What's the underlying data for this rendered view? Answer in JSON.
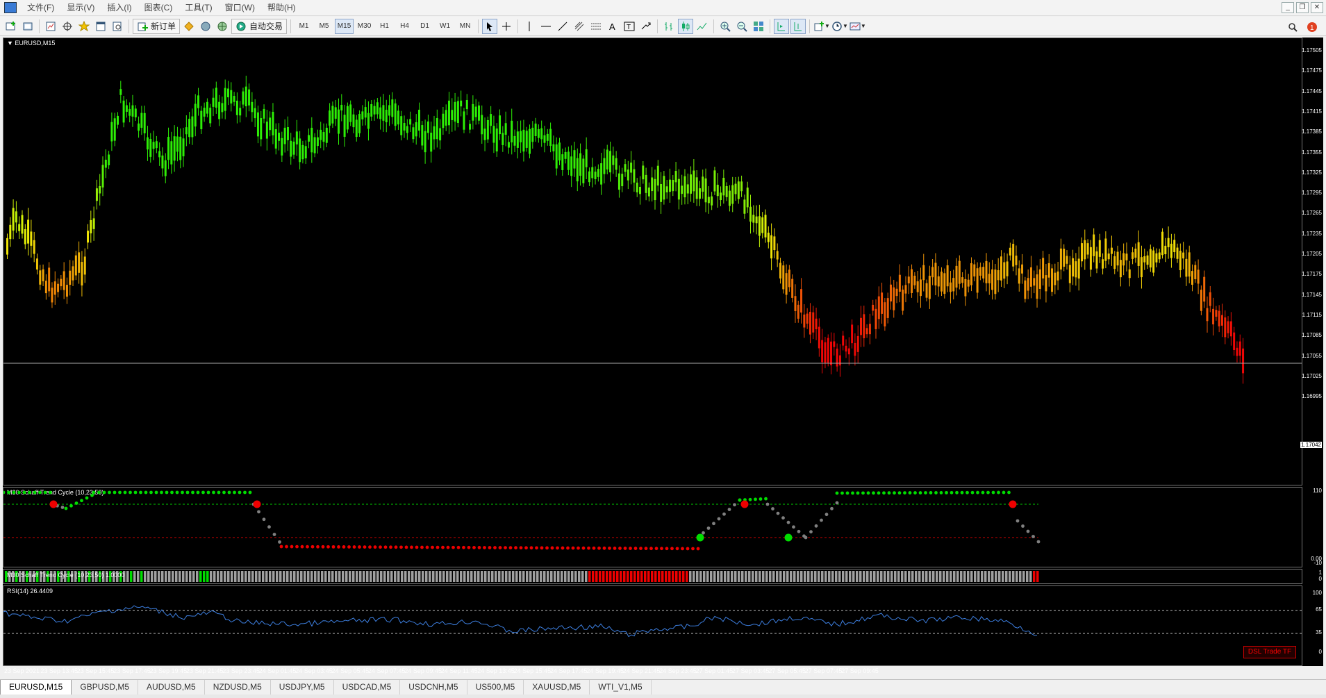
{
  "menu": [
    "文件(F)",
    "显示(V)",
    "插入(I)",
    "图表(C)",
    "工具(T)",
    "窗口(W)",
    "帮助(H)"
  ],
  "toolbar": {
    "new_order": "新订单",
    "auto_trading": "自动交易",
    "timeframes": [
      "M1",
      "M5",
      "M15",
      "M30",
      "H1",
      "H4",
      "D1",
      "W1",
      "MN"
    ],
    "active_timeframe": "M15"
  },
  "chart": {
    "title": "EURUSD,M15",
    "current_price": "1.17042",
    "price_labels": [
      "1.17505",
      "1.17475",
      "1.17445",
      "1.17415",
      "1.17385",
      "1.17355",
      "1.17325",
      "1.17295",
      "1.17265",
      "1.17235",
      "1.17205",
      "1.17175",
      "1.17145",
      "1.17115",
      "1.17085",
      "1.17055",
      "1.17025",
      "1.16995"
    ],
    "stc_title": "M30 Schaff Trend Cycle (10,23,50)",
    "stc_bar_title": "M30 Schaff Trend Cycle (10,23,50) 1.0000",
    "stc_axis": [
      "110",
      "0.00",
      "-10"
    ],
    "stc_bar_axis": [
      "1",
      "0"
    ],
    "rsi_title": "RSI(14) 26.4409",
    "rsi_axis": [
      "100",
      "65",
      "35",
      "0"
    ],
    "time_labels": [
      "23 Sep 2021",
      "23 Sep 13:45",
      "23 Sep 15:45",
      "23 Sep 17:45",
      "23 Sep 19:45",
      "23 Sep 21:45",
      "23 Sep 23:45",
      "24 Sep 01:45",
      "24 Sep 03:45",
      "24 Sep 05:45",
      "24 Sep 07:45",
      "24 Sep 09:45",
      "24 Sep 11:45",
      "24 Sep 13:45",
      "24 Sep 15:45",
      "24 Sep 17:45",
      "24 Sep 19:45",
      "24 Sep 21:45",
      "24 Sep 23:45",
      "27 Sep 01:45",
      "27 Sep 03:45",
      "27 Sep 05:45",
      "27 Sep 07:45",
      "27 Sep 09:45"
    ],
    "dsl_label": "DSL Trade TF"
  },
  "tabs": [
    "EURUSD,M15",
    "GBPUSD,M5",
    "AUDUSD,M5",
    "NZDUSD,M5",
    "USDJPY,M5",
    "USDCAD,M5",
    "USDCNH,M5",
    "US500,M5",
    "XAUUSD,M5",
    "WTI_V1,M5"
  ],
  "active_tab": "EURUSD,M15",
  "colors": {
    "background": "#000000",
    "bull_green": "#39d018",
    "bear_red": "#ff1a00",
    "stc_green": "#00dd00",
    "stc_red": "#ee0000",
    "stc_gray": "#808080",
    "rsi_line": "#3d7fe0"
  }
}
